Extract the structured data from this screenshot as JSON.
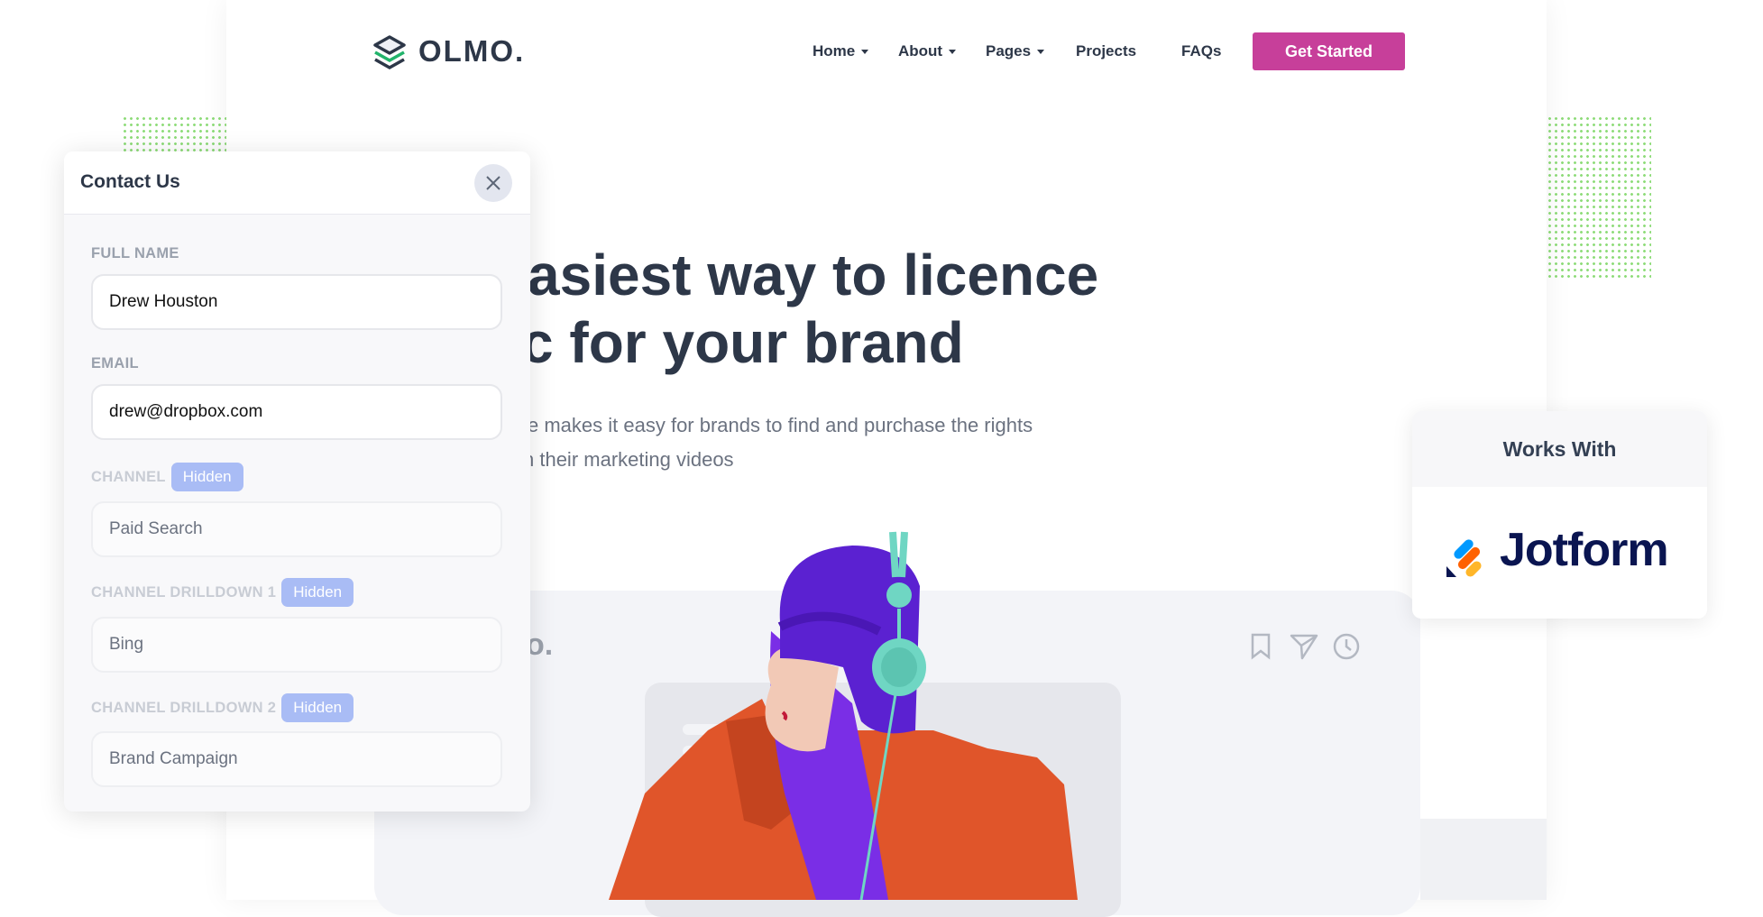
{
  "brand": {
    "name": "OLMO."
  },
  "nav": {
    "items": [
      {
        "label": "Home",
        "dropdown": true
      },
      {
        "label": "About",
        "dropdown": true
      },
      {
        "label": "Pages",
        "dropdown": true
      },
      {
        "label": "Projects",
        "dropdown": false
      },
      {
        "label": "FAQs",
        "dropdown": false
      }
    ],
    "cta": "Get Started",
    "cta_color": "#c73f9a"
  },
  "hero": {
    "line1": "asiest way to licence",
    "line2": "c for your brand",
    "sub1": "e makes it easy for brands to find and purchase the rights",
    "sub2": "n their marketing videos"
  },
  "mock": {
    "logo_fragment": "o.",
    "icons": [
      "bookmark-icon",
      "send-icon",
      "clock-icon"
    ]
  },
  "contact": {
    "title": "Contact Us",
    "fields": [
      {
        "label": "FULL NAME",
        "value": "Drew Houston"
      },
      {
        "label": "EMAIL",
        "value": "drew@dropbox.com"
      },
      {
        "label": "CHANNEL",
        "badge": "Hidden",
        "value": "Paid Search"
      },
      {
        "label": "CHANNEL DRILLDOWN 1",
        "badge": "Hidden",
        "value": "Bing"
      },
      {
        "label": "CHANNEL DRILLDOWN 2",
        "badge": "Hidden",
        "value": "Brand Campaign"
      }
    ]
  },
  "works_with": {
    "title": "Works With",
    "partner": "Jotform"
  }
}
